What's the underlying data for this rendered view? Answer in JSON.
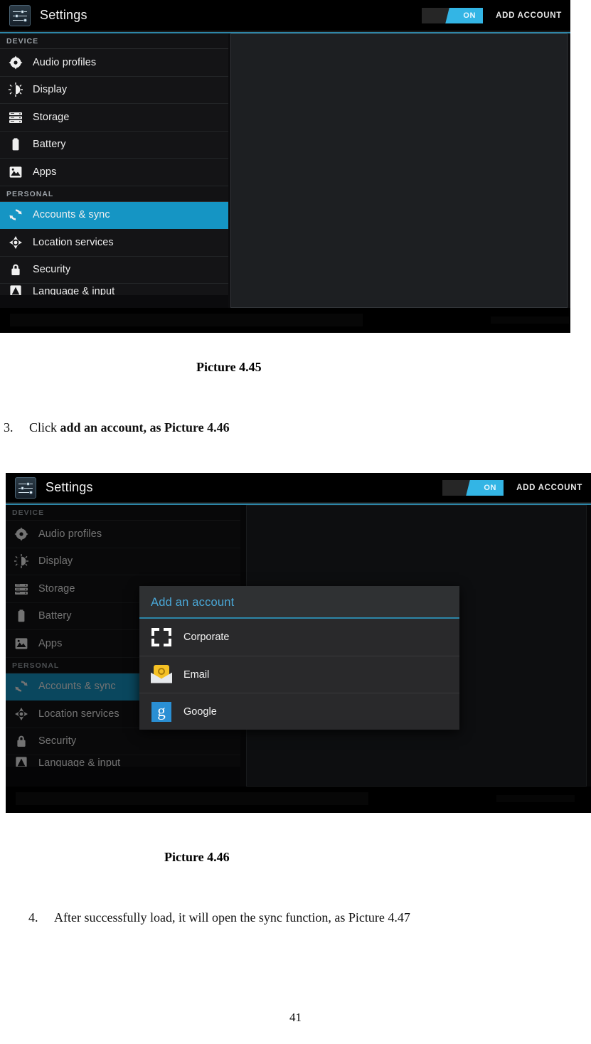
{
  "page": {
    "number": "41"
  },
  "captions": {
    "figure_1": "Picture 4.45",
    "figure_2": "Picture 4.46"
  },
  "steps": [
    {
      "number": "3.",
      "text_plain": "Click ",
      "text_bold": "add an account, as Picture 4.46"
    },
    {
      "number": "4.",
      "text_plain": "After successfully load, it will open the sync function, as Picture 4.47",
      "text_bold": ""
    }
  ],
  "screenshot_1": {
    "actionbar": {
      "app_icon": "settings-sliders-icon",
      "title": "Settings",
      "toggle": {
        "state_label": "ON",
        "checked": true,
        "accent_color": "#33b5e5"
      },
      "add_account_label": "ADD ACCOUNT"
    },
    "sidebar": {
      "groups": [
        {
          "header": "DEVICE",
          "items": [
            {
              "label": "Audio profiles",
              "icon": "audio-profiles-icon",
              "selected": false
            },
            {
              "label": "Display",
              "icon": "display-icon",
              "selected": false
            },
            {
              "label": "Storage",
              "icon": "storage-icon",
              "selected": false
            },
            {
              "label": "Battery",
              "icon": "battery-icon",
              "selected": false
            },
            {
              "label": "Apps",
              "icon": "apps-icon",
              "selected": false
            }
          ]
        },
        {
          "header": "PERSONAL",
          "items": [
            {
              "label": "Accounts & sync",
              "icon": "sync-icon",
              "selected": true
            },
            {
              "label": "Location services",
              "icon": "location-icon",
              "selected": false
            },
            {
              "label": "Security",
              "icon": "lock-icon",
              "selected": false
            },
            {
              "label": "Language & input",
              "icon": "language-icon",
              "selected": false
            }
          ]
        }
      ]
    },
    "content_pane": {
      "empty": true,
      "background_color": "#1d1f22"
    }
  },
  "screenshot_2": {
    "actionbar": {
      "app_icon": "settings-sliders-icon",
      "title": "Settings",
      "toggle": {
        "state_label": "ON",
        "checked": true,
        "accent_color": "#33b5e5"
      },
      "add_account_label": "ADD ACCOUNT"
    },
    "sidebar": {
      "groups": [
        {
          "header": "DEVICE",
          "items": [
            {
              "label": "Audio profiles",
              "icon": "audio-profiles-icon",
              "selected": false
            },
            {
              "label": "Display",
              "icon": "display-icon",
              "selected": false
            },
            {
              "label": "Storage",
              "icon": "storage-icon",
              "selected": false
            },
            {
              "label": "Battery",
              "icon": "battery-icon",
              "selected": false
            },
            {
              "label": "Apps",
              "icon": "apps-icon",
              "selected": false
            }
          ]
        },
        {
          "header": "PERSONAL",
          "items": [
            {
              "label": "Accounts & sync",
              "icon": "sync-icon",
              "selected": true
            },
            {
              "label": "Location services",
              "icon": "location-icon",
              "selected": false
            },
            {
              "label": "Security",
              "icon": "lock-icon",
              "selected": false
            },
            {
              "label": "Language & input",
              "icon": "language-icon",
              "selected": false
            }
          ]
        }
      ]
    },
    "dialog": {
      "title": "Add an account",
      "accent_color": "#2d86a8",
      "title_color": "#4aa8d8",
      "options": [
        {
          "label": "Corporate",
          "icon": "corporate-icon"
        },
        {
          "label": "Email",
          "icon": "email-icon"
        },
        {
          "label": "Google",
          "icon": "google-icon",
          "glyph": "g"
        }
      ]
    }
  }
}
